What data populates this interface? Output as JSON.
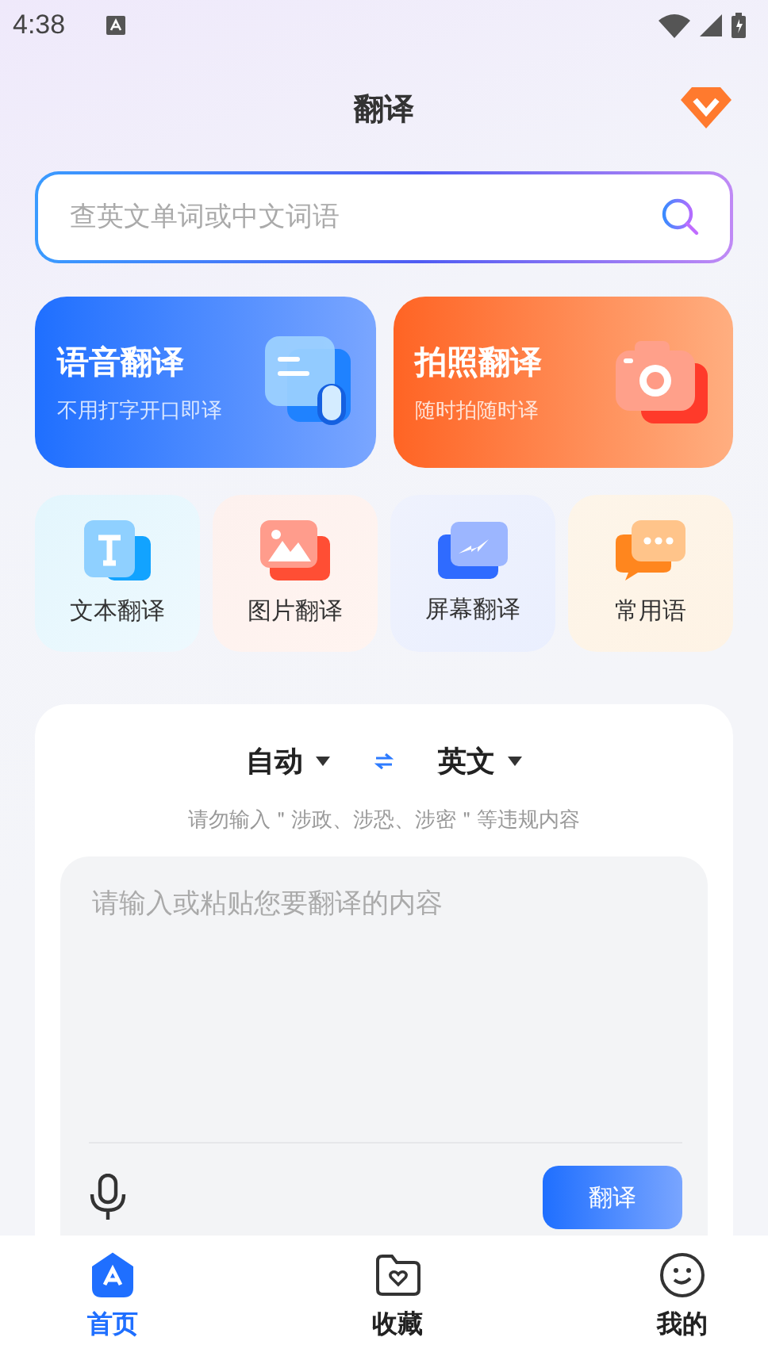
{
  "status_bar": {
    "time": "4:38"
  },
  "header": {
    "title": "翻译"
  },
  "search": {
    "placeholder": "查英文单词或中文词语"
  },
  "feature_cards": [
    {
      "kind": "voice",
      "title": "语音翻译",
      "subtitle": "不用打字开口即译"
    },
    {
      "kind": "photo",
      "title": "拍照翻译",
      "subtitle": "随时拍随时译"
    }
  ],
  "tools": [
    {
      "kind": "text",
      "label": "文本翻译"
    },
    {
      "kind": "image",
      "label": "图片翻译"
    },
    {
      "kind": "screen",
      "label": "屏幕翻译"
    },
    {
      "kind": "phrase",
      "label": "常用语"
    }
  ],
  "translator": {
    "source_language": "自动",
    "target_language": "英文",
    "notice": "请勿输入＂涉政、涉恐、涉密＂等违规内容",
    "placeholder": "请输入或粘贴您要翻译的内容",
    "button": "翻译"
  },
  "bottom_nav": [
    {
      "kind": "home",
      "label": "首页",
      "selected": true
    },
    {
      "kind": "favorites",
      "label": "收藏",
      "selected": false
    },
    {
      "kind": "profile",
      "label": "我的",
      "selected": false
    }
  ]
}
